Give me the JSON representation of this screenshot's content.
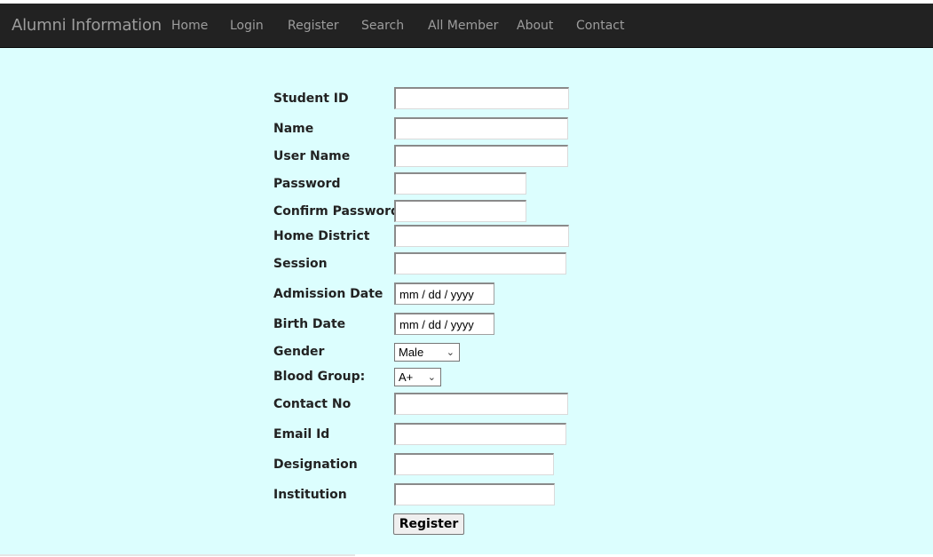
{
  "navbar": {
    "brand": "Alumni Information",
    "items": [
      "Home",
      "Login",
      "Register",
      "Search",
      "All Member",
      "About",
      "Contact"
    ]
  },
  "form": {
    "labels": {
      "student_id": "Student ID",
      "name": "Name",
      "user_name": "User Name",
      "password": "Password",
      "confirm_password": "Confirm Password",
      "home_district": "Home District",
      "session": "Session",
      "admission_date": "Admission Date",
      "birth_date": "Birth Date",
      "gender": "Gender",
      "blood_group": "Blood Group:",
      "contact_no": "Contact No",
      "email_id": "Email Id",
      "designation": "Designation",
      "institution": "Institution"
    },
    "date_placeholder": "mm / dd / yyyy",
    "gender_selected": "Male",
    "blood_group_selected": "A+",
    "register_label": "Register"
  },
  "colors": {
    "navbar_bg": "#222222",
    "nav_text": "#9d9d9d",
    "content_bg": "#dcfefe"
  }
}
